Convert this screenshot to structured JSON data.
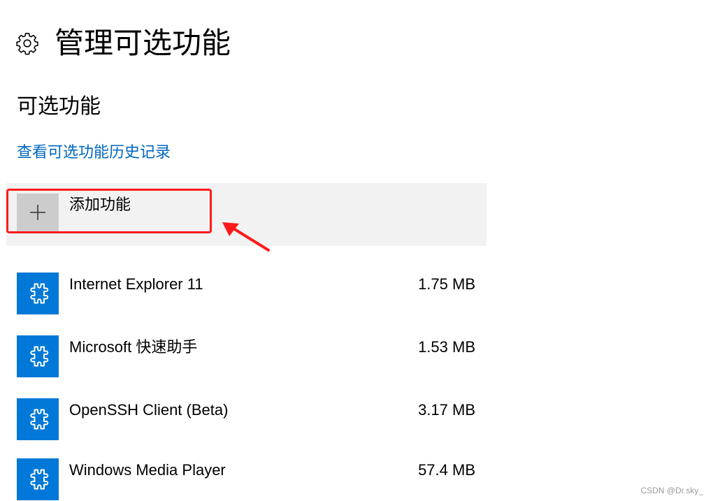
{
  "header": {
    "icon": "gear-icon",
    "title": "管理可选功能"
  },
  "section": {
    "title": "可选功能",
    "history_link": "查看可选功能历史记录"
  },
  "add_feature": {
    "icon": "plus-icon",
    "label": "添加功能"
  },
  "features": [
    {
      "icon": "puzzle-icon",
      "name": "Internet Explorer 11",
      "size": "1.75 MB"
    },
    {
      "icon": "puzzle-icon",
      "name": "Microsoft 快速助手",
      "size": "1.53 MB"
    },
    {
      "icon": "puzzle-icon",
      "name": "OpenSSH Client (Beta)",
      "size": "3.17 MB"
    },
    {
      "icon": "puzzle-icon",
      "name": "Windows Media Player",
      "size": "57.4 MB"
    }
  ],
  "watermark": "CSDN @Dr.sky_",
  "colors": {
    "link": "#0067c0",
    "accent": "#0078d7",
    "highlight": "#ff1a1a",
    "add_row_bg": "#f2f2f2"
  }
}
